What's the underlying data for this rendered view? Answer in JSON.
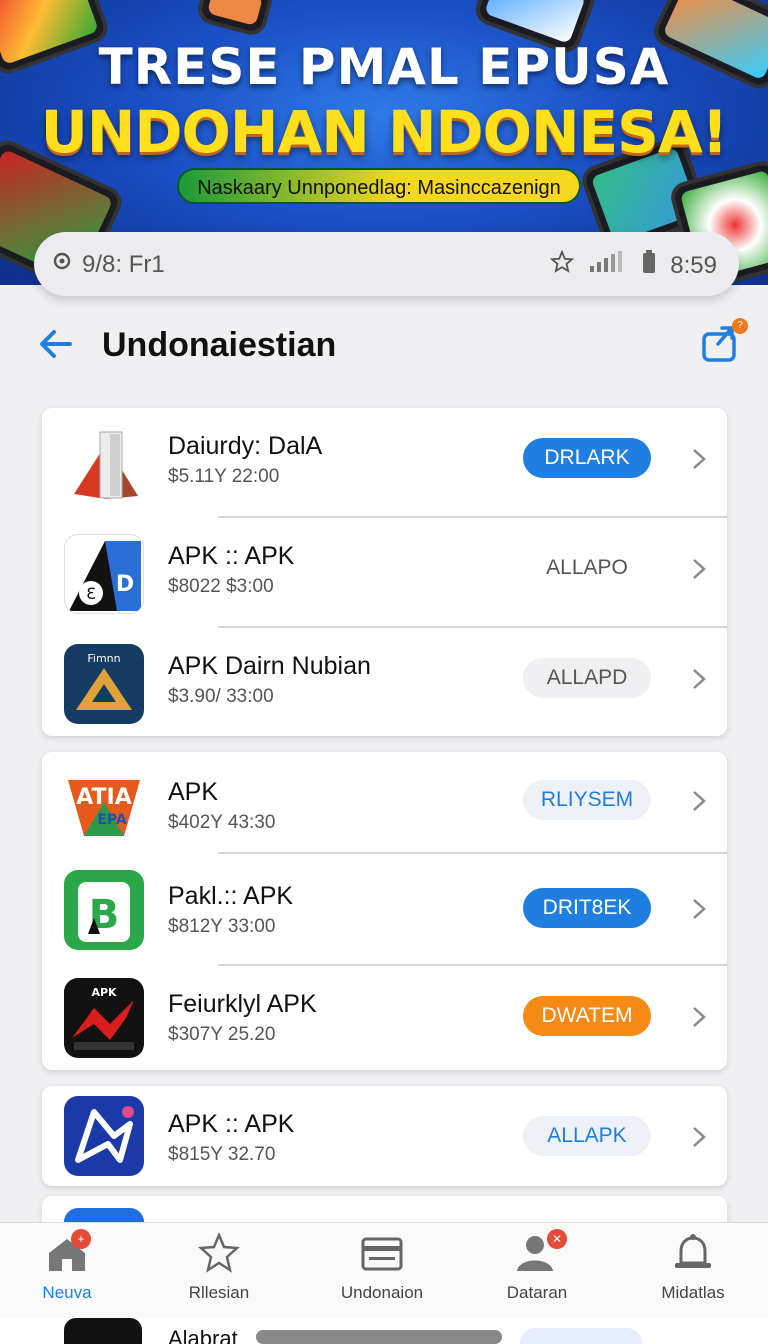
{
  "banner": {
    "title_line1": "TRESE PMAL EPUSA",
    "title_line2": "UNDOHAN NDONESA!",
    "subtitle": "Naskaary Unnponedlag: Masinccazenign"
  },
  "statusbar": {
    "left_text": "9/8: Fr1",
    "time": "8:59",
    "icons": [
      "location-icon",
      "star-icon",
      "signal-icon",
      "battery-icon"
    ]
  },
  "header": {
    "title": "Undonaiestian",
    "share_badge": "?"
  },
  "apps": [
    {
      "name": "Daiurdy: DalA",
      "price": "$5.11Y 22:00",
      "button": "DRLARK",
      "style": "blue"
    },
    {
      "name": "APK :: APK",
      "price": "$8022 $3:00",
      "button": "ALLAPO",
      "style": "plain"
    },
    {
      "name": "APK Dairn Nubian",
      "price": "$3.90/ 33:00",
      "button": "ALLAPD",
      "style": "grey"
    },
    {
      "name": "APK",
      "price": "$402Y 43:30",
      "button": "RLIYSEM",
      "style": "ghost"
    },
    {
      "name": "Pakl.:: APK",
      "price": "$812Y 33:00",
      "button": "DRIT8EK",
      "style": "blue"
    },
    {
      "name": "Feiurklyl  APK",
      "price": "$307Y 25.20",
      "button": "DWATEM",
      "style": "orange"
    },
    {
      "name": "APK :: APK",
      "price": "$815Y 32.70",
      "button": "ALLAPK",
      "style": "ghost"
    }
  ],
  "icon_texts": {
    "app2": "Ɛ",
    "app2_right": "D",
    "app3": "Fimnn",
    "app4_top": "ATIA",
    "app4_bottom": "EPA",
    "app6_top": "APK"
  },
  "bottom_nav": [
    {
      "label": "Neuva",
      "icon": "home-icon",
      "badge": "+"
    },
    {
      "label": "Rllesian",
      "icon": "star-icon",
      "badge": ""
    },
    {
      "label": "Undonaion",
      "icon": "card-icon",
      "badge": ""
    },
    {
      "label": "Dataran",
      "icon": "person-icon",
      "badge": "✕"
    },
    {
      "label": "Midatlas",
      "icon": "bell-icon",
      "badge": ""
    }
  ],
  "peek": {
    "text": "Alabrat"
  },
  "colors": {
    "accent": "#1f7fe0",
    "orange": "#f58a14",
    "banner_yellow": "#ffe01a"
  }
}
